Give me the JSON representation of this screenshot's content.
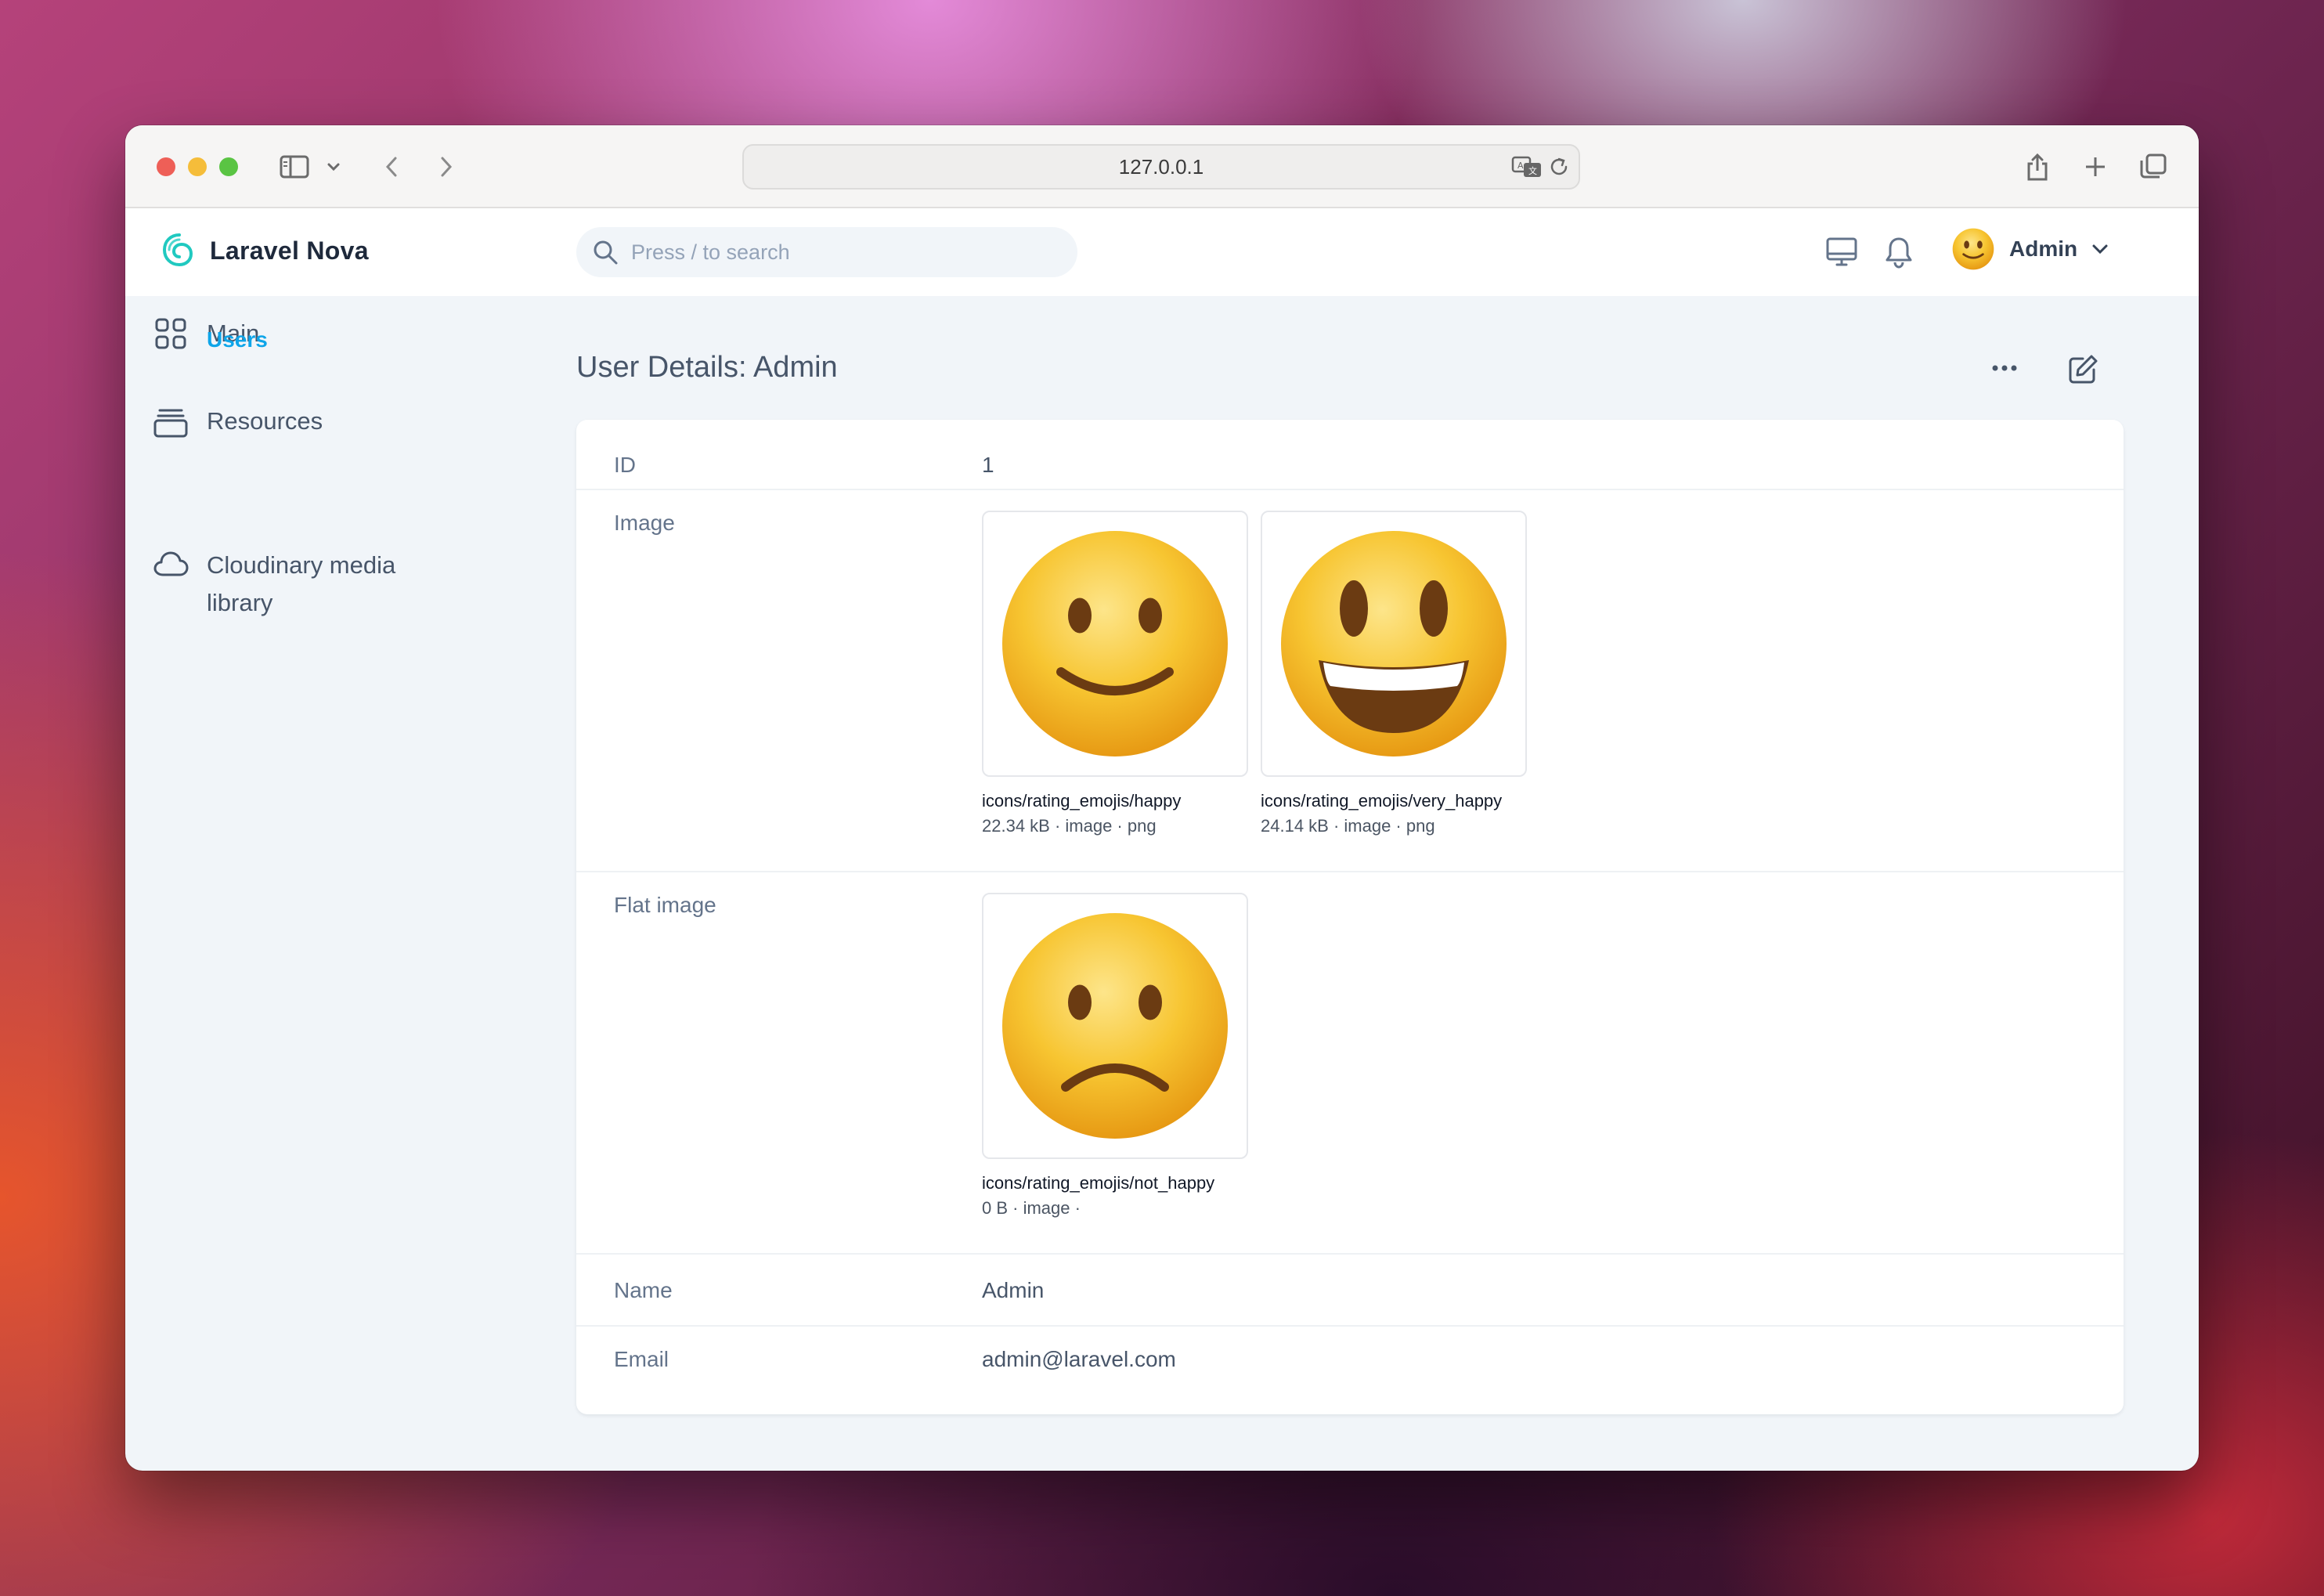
{
  "browser": {
    "url": "127.0.0.1"
  },
  "header": {
    "logo_text": "Laravel Nova",
    "search_placeholder": "Press / to search",
    "user_name": "Admin"
  },
  "sidebar": {
    "items": [
      {
        "label": "Main",
        "icon": "grid-icon"
      },
      {
        "label": "Resources",
        "icon": "archive-icon"
      },
      {
        "label": "Cloudinary media library",
        "icon": "cloud-icon"
      }
    ],
    "sub_items": [
      {
        "label": "Users"
      }
    ]
  },
  "page": {
    "title": "User Details: Admin"
  },
  "details": {
    "id": {
      "label": "ID",
      "value": "1"
    },
    "image": {
      "label": "Image",
      "files": [
        {
          "name": "icons/rating_emojis/happy",
          "meta": "22.34 kB · image · png",
          "icon": "happy-emoji"
        },
        {
          "name": "icons/rating_emojis/very_happy",
          "meta": "24.14 kB · image · png",
          "icon": "very-happy-emoji"
        }
      ]
    },
    "flat_image": {
      "label": "Flat image",
      "files": [
        {
          "name": "icons/rating_emojis/not_happy",
          "meta": "0 B · image ·",
          "icon": "not-happy-emoji"
        }
      ]
    },
    "name": {
      "label": "Name",
      "value": "Admin"
    },
    "email": {
      "label": "Email",
      "value": "admin@laravel.com"
    }
  },
  "colors": {
    "accent": "#0ea5e9",
    "emoji_yellow": "#f7c531"
  }
}
